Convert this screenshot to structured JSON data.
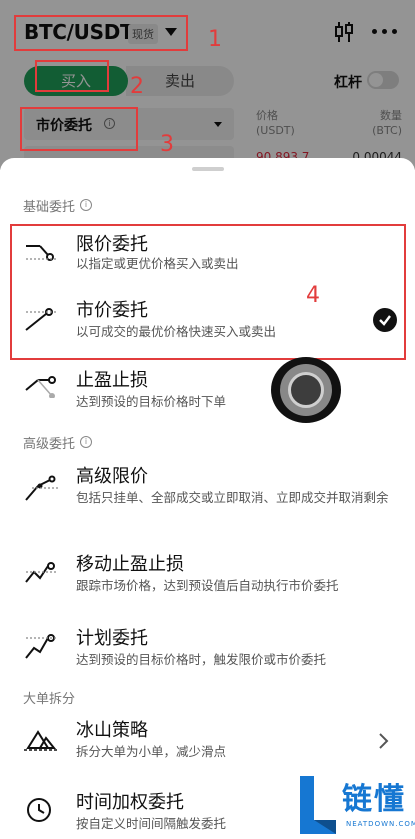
{
  "header": {
    "pair": "BTC/USDT",
    "market_badge": "现货",
    "icons": {
      "chart": "kline-chart-icon",
      "more": "more-dots-icon"
    }
  },
  "trade_tabs": {
    "buy": "买入",
    "sell": "卖出"
  },
  "leverage": {
    "label": "杠杆",
    "enabled": false
  },
  "order_type_select": {
    "value": "市价委托"
  },
  "order_book": {
    "price_header": "价格\n(USDT)",
    "amount_header": "数量\n(BTC)",
    "first_price": "90,893.7",
    "first_amount": "0.00044"
  },
  "sheet": {
    "sections": [
      {
        "title": "基础委托",
        "options": [
          {
            "title": "限价委托",
            "desc": "以指定或更优价格买入或卖出",
            "icon": "limit-order-icon",
            "selected": false
          },
          {
            "title": "市价委托",
            "desc": "以可成交的最优价格快速买入或卖出",
            "icon": "market-order-icon",
            "selected": true
          },
          {
            "title": "止盈止损",
            "desc": "达到预设的目标价格时下单",
            "icon": "tp-sl-icon",
            "selected": false
          }
        ]
      },
      {
        "title": "高级委托",
        "options": [
          {
            "title": "高级限价",
            "desc": "包括只挂单、全部成交或立即取消、立即成交并取消剩余",
            "icon": "advanced-limit-icon"
          },
          {
            "title": "移动止盈止损",
            "desc": "跟踪市场价格，达到预设值后自动执行市价委托",
            "icon": "trailing-stop-icon"
          },
          {
            "title": "计划委托",
            "desc": "达到预设的目标价格时，触发限价或市价委托",
            "icon": "trigger-order-icon"
          }
        ]
      },
      {
        "title": "大单拆分",
        "options": [
          {
            "title": "冰山策略",
            "desc": "拆分大单为小单，减少滑点",
            "icon": "iceberg-icon",
            "has_chevron": true
          },
          {
            "title": "时间加权委托",
            "desc": "按自定义时间间隔触发委托",
            "icon": "twap-clock-icon"
          }
        ]
      }
    ]
  },
  "annotations": [
    "1",
    "2",
    "3",
    "4"
  ],
  "watermark": {
    "brand": "链懂",
    "sub": "NEATDOWN.COM"
  },
  "colors": {
    "buy_green": "#1fa05a",
    "sell_red": "#e0293d",
    "annotation_red": "#e23c3c",
    "watermark_blue": "#1677d2"
  }
}
